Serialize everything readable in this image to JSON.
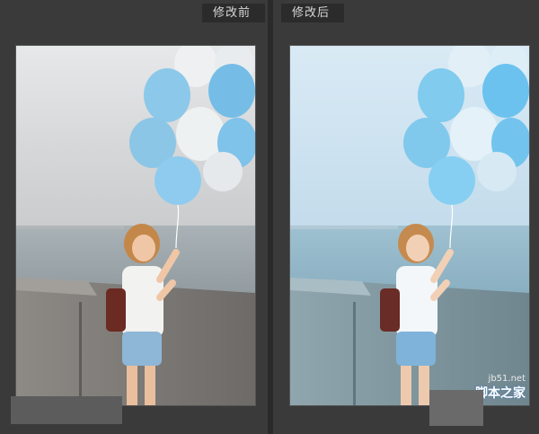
{
  "tabs": {
    "before_label": "修改前",
    "after_label": "修改后"
  },
  "watermark": {
    "site": "jb51.net",
    "name": "脚本之家"
  },
  "colors": {
    "background": "#3a3a3a",
    "tab_bg": "#2b2b2b",
    "tab_text": "#d8d8d8",
    "before_sky": "#d9dadb",
    "after_sky": "#cfe3f1",
    "balloon_blue": "#7fc3ea",
    "balloon_white": "#eef1f2"
  },
  "images": {
    "before": "photo-before",
    "after": "photo-after"
  }
}
